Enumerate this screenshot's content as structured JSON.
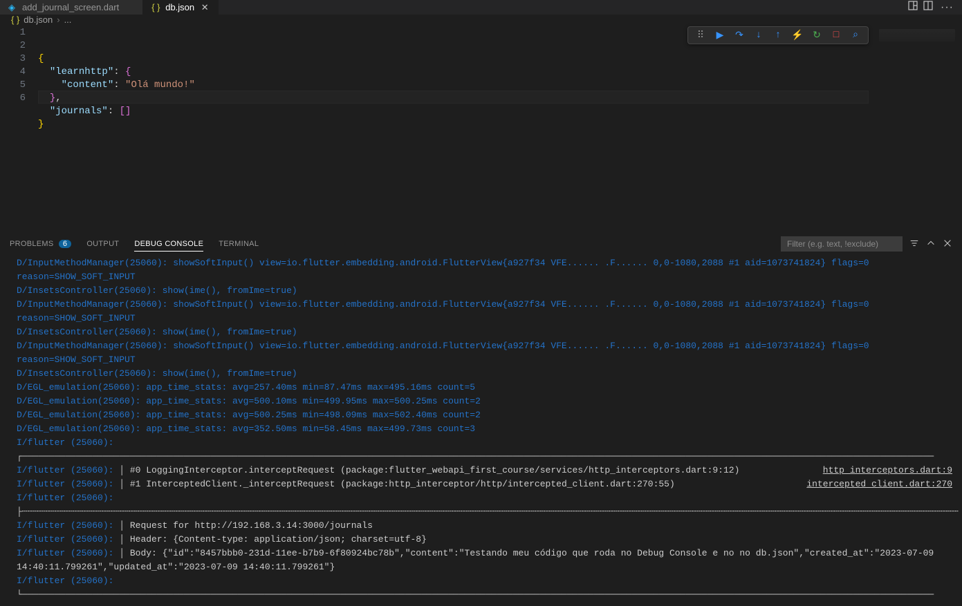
{
  "tabs": [
    {
      "icon": "dart",
      "label": "add_journal_screen.dart",
      "active": false
    },
    {
      "icon": "json",
      "label": "db.json",
      "active": true
    }
  ],
  "breadcrumb": {
    "icon": "json",
    "file": "db.json",
    "trail": "..."
  },
  "editor": {
    "lines": [
      "1",
      "2",
      "3",
      "4",
      "5",
      "6"
    ],
    "code": {
      "l1_brace": "{",
      "l2_key": "\"learnhttp\"",
      "l2_colon": ":",
      "l2_brace": "{",
      "l3_key": "\"content\"",
      "l3_colon": ":",
      "l3_val": "\"Olá mundo!\"",
      "l4_brace": "}",
      "l4_comma": ",",
      "l5_key": "\"journals\"",
      "l5_colon": ":",
      "l5_brkt": "[]",
      "l6_brace": "}"
    }
  },
  "panel": {
    "tabs": {
      "problems": "PROBLEMS",
      "problems_badge": "6",
      "output": "OUTPUT",
      "debug": "DEBUG CONSOLE",
      "terminal": "TERMINAL"
    },
    "filter_placeholder": "Filter (e.g. text, !exclude)"
  },
  "console": {
    "lines": [
      {
        "cls": "log-d",
        "txt": "D/InputMethodManager(25060): showSoftInput() view=io.flutter.embedding.android.FlutterView{a927f34 VFE...... .F...... 0,0-1080,2088 #1 aid=1073741824} flags=0 reason=SHOW_SOFT_INPUT"
      },
      {
        "cls": "log-d",
        "txt": "D/InsetsController(25060): show(ime(), fromIme=true)"
      },
      {
        "cls": "log-d",
        "txt": "D/InputMethodManager(25060): showSoftInput() view=io.flutter.embedding.android.FlutterView{a927f34 VFE...... .F...... 0,0-1080,2088 #1 aid=1073741824} flags=0 reason=SHOW_SOFT_INPUT"
      },
      {
        "cls": "log-d",
        "txt": "D/InsetsController(25060): show(ime(), fromIme=true)"
      },
      {
        "cls": "log-d",
        "txt": "D/InputMethodManager(25060): showSoftInput() view=io.flutter.embedding.android.FlutterView{a927f34 VFE...... .F...... 0,0-1080,2088 #1 aid=1073741824} flags=0 reason=SHOW_SOFT_INPUT"
      },
      {
        "cls": "log-d",
        "txt": "D/InsetsController(25060): show(ime(), fromIme=true)"
      },
      {
        "cls": "log-d",
        "txt": "D/EGL_emulation(25060): app_time_stats: avg=257.40ms min=87.47ms max=495.16ms count=5"
      },
      {
        "cls": "log-d",
        "txt": "D/EGL_emulation(25060): app_time_stats: avg=500.10ms min=499.95ms max=500.25ms count=2"
      },
      {
        "cls": "log-d",
        "txt": "D/EGL_emulation(25060): app_time_stats: avg=500.25ms min=498.09ms max=502.40ms count=2"
      },
      {
        "cls": "log-d",
        "txt": "D/EGL_emulation(25060): app_time_stats: avg=352.50ms min=58.45ms max=499.73ms count=3"
      },
      {
        "cls": "mixed",
        "prefix": "I/flutter (25060):",
        "body": " ┌─────────────────────────────────────────────────────────────────────────────────────────────────────────────────────────────────────────────────────────────────────────"
      },
      {
        "cls": "mixed",
        "prefix": "I/flutter (25060):",
        "body": " │ #0   LoggingInterceptor.interceptRequest (package:flutter_webapi_first_course/services/http_interceptors.dart:9:12)",
        "link": "http_interceptors.dart:9"
      },
      {
        "cls": "mixed",
        "prefix": "I/flutter (25060):",
        "body": " │ #1   InterceptedClient._interceptRequest (package:http_interceptor/http/intercepted_client.dart:270:55)",
        "link": "intercepted_client.dart:270"
      },
      {
        "cls": "mixed",
        "prefix": "I/flutter (25060):",
        "body": " ├┄┄┄┄┄┄┄┄┄┄┄┄┄┄┄┄┄┄┄┄┄┄┄┄┄┄┄┄┄┄┄┄┄┄┄┄┄┄┄┄┄┄┄┄┄┄┄┄┄┄┄┄┄┄┄┄┄┄┄┄┄┄┄┄┄┄┄┄┄┄┄┄┄┄┄┄┄┄┄┄┄┄┄┄┄┄┄┄┄┄┄┄┄┄┄┄┄┄┄┄┄┄┄┄┄┄┄┄┄┄┄┄┄┄┄┄┄┄┄┄┄┄┄┄┄┄┄┄┄┄┄┄┄┄┄┄┄┄┄┄┄┄┄┄┄┄┄┄┄┄┄┄┄┄┄┄┄┄┄┄┄┄┄┄┄┄┄┄┄┄┄┄┄"
      },
      {
        "cls": "mixed",
        "prefix": "I/flutter (25060):",
        "body": " │ Request for http://192.168.3.14:3000/journals"
      },
      {
        "cls": "mixed",
        "prefix": "I/flutter (25060):",
        "body": " │ Header: {Content-type: application/json; charset=utf-8}"
      },
      {
        "cls": "mixed",
        "prefix": "I/flutter (25060):",
        "body": " │ Body: {\"id\":\"8457bbb0-231d-11ee-b7b9-6f80924bc78b\",\"content\":\"Testando meu código que roda no Debug Console e no no db.json\",\"created_at\":\"2023-07-09 14:40:11.799261\",\"updated_at\":\"2023-07-09 14:40:11.799261\"}"
      },
      {
        "cls": "mixed",
        "prefix": "I/flutter (25060):",
        "body": " └─────────────────────────────────────────────────────────────────────────────────────────────────────────────────────────────────────────────────────────────────────────"
      }
    ]
  }
}
